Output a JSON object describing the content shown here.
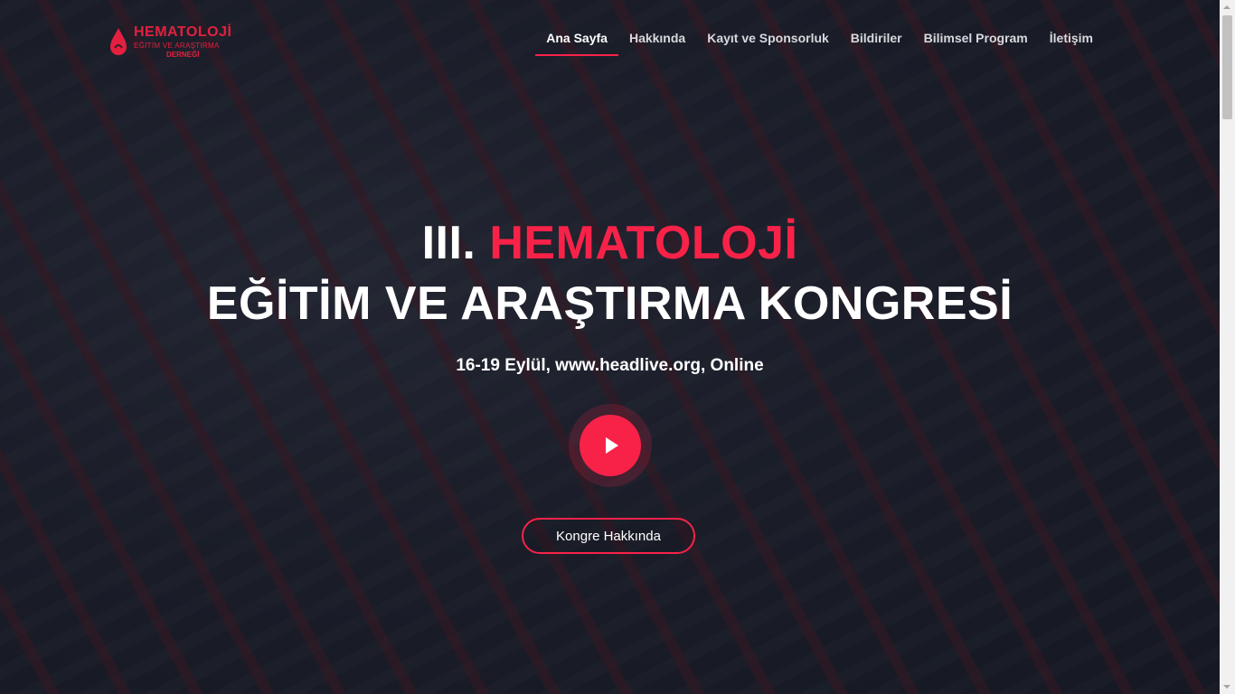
{
  "logo": {
    "line1": "HEMATOLOJİ",
    "line2": "EĞİTİM VE ARAŞTIRMA",
    "line3": "DERNEĞİ",
    "icon": "blood-drop-icon",
    "color": "#e3203f"
  },
  "nav": {
    "items": [
      {
        "label": "Ana Sayfa",
        "active": true
      },
      {
        "label": "Hakkında"
      },
      {
        "label": "Kayıt ve Sponsorluk"
      },
      {
        "label": "Bildiriler"
      },
      {
        "label": "Bilimsel Program"
      },
      {
        "label": "İletişim"
      }
    ]
  },
  "hero": {
    "title_prefix": "III.",
    "title_accent": "HEMATOLOJİ",
    "title_line2": "EĞİTİM VE ARAŞTIRMA KONGRESİ",
    "subtitle": "16-19 Eylül, www.headlive.org, Online",
    "play_icon": "play-icon",
    "cta_label": "Kongre Hakkında"
  },
  "colors": {
    "accent": "#f82249",
    "text": "#ffffff",
    "overlay": "#141622"
  }
}
